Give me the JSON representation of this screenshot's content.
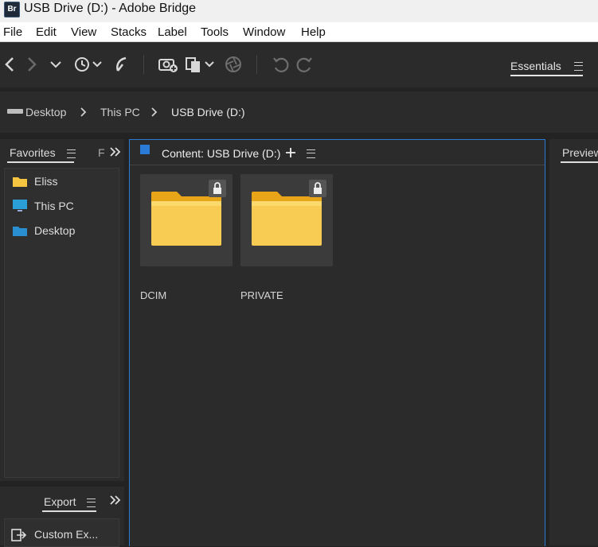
{
  "window": {
    "app_icon": "Br",
    "title": "USB Drive (D:) - Adobe Bridge"
  },
  "menu": [
    "File",
    "Edit",
    "View",
    "Stacks",
    "Label",
    "Tools",
    "Window",
    "Help"
  ],
  "toolbar": {
    "workspace": "Essentials"
  },
  "path": {
    "items": [
      "Desktop",
      "This PC",
      "USB Drive (D:)"
    ]
  },
  "favorites_panel": {
    "tab": "Favorites",
    "tab2": "F",
    "items": [
      "Eliss",
      "This PC",
      "Desktop"
    ]
  },
  "export_panel": {
    "tab": "Export",
    "item": "Custom Ex..."
  },
  "content_panel": {
    "tab": "Content: USB Drive (D:)",
    "items": [
      "DCIM",
      "PRIVATE"
    ]
  },
  "preview_panel": {
    "tab": "Preview"
  },
  "colors": {
    "accent_blue": "#2a7bd6",
    "folder_yellow": "#f5c542"
  }
}
